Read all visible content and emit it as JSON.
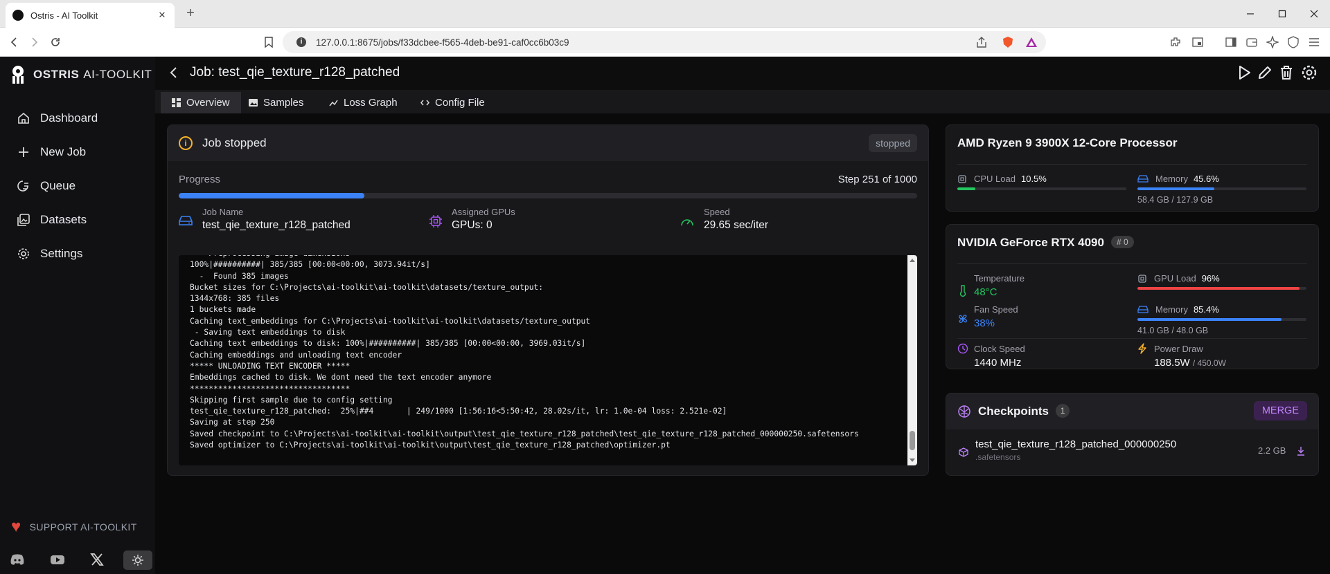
{
  "browser": {
    "tab_title": "Ostris - AI Toolkit",
    "url": "127.0.0.1:8675/jobs/f33dcbee-f565-4deb-be91-caf0cc6b03c9"
  },
  "sidebar": {
    "brand_bold": "OSTRIS",
    "brand_rest": "AI-TOOLKIT",
    "items": [
      {
        "label": "Dashboard",
        "icon": "home-icon"
      },
      {
        "label": "New Job",
        "icon": "plus-icon"
      },
      {
        "label": "Queue",
        "icon": "queue-icon"
      },
      {
        "label": "Datasets",
        "icon": "images-icon"
      },
      {
        "label": "Settings",
        "icon": "gear-icon"
      }
    ],
    "support_label": "SUPPORT AI-TOOLKIT"
  },
  "header": {
    "title": "Job: test_qie_texture_r128_patched"
  },
  "tabs": [
    {
      "label": "Overview",
      "active": true
    },
    {
      "label": "Samples"
    },
    {
      "label": "Loss Graph"
    },
    {
      "label": "Config File"
    }
  ],
  "job": {
    "status_title": "Job stopped",
    "status_badge": "stopped",
    "progress_label": "Progress",
    "step_text": "Step 251 of 1000",
    "progress_fraction": 0.251,
    "job_name_label": "Job Name",
    "job_name": "test_qie_texture_r128_patched",
    "gpus_label": "Assigned GPUs",
    "gpus": "GPUs: 0",
    "speed_label": "Speed",
    "speed": "29.65 sec/iter",
    "log": "  - Preprocessing image dimensions\n100%|##########| 385/385 [00:00<00:00, 3073.94it/s]\n  -  Found 385 images\nBucket sizes for C:\\Projects\\ai-toolkit\\ai-toolkit\\datasets/texture_output:\n1344x768: 385 files\n1 buckets made\nCaching text_embeddings for C:\\Projects\\ai-toolkit\\ai-toolkit\\datasets/texture_output\n - Saving text embeddings to disk\nCaching text embeddings to disk: 100%|##########| 385/385 [00:00<00:00, 3969.03it/s]\nCaching embeddings and unloading text encoder\n***** UNLOADING TEXT ENCODER *****\nEmbeddings cached to disk. We dont need the text encoder anymore\n**********************************\nSkipping first sample due to config setting\ntest_qie_texture_r128_patched:  25%|##4       | 249/1000 [1:56:16<5:50:42, 28.02s/it, lr: 1.0e-04 loss: 2.521e-02]\nSaving at step 250\nSaved checkpoint to C:\\Projects\\ai-toolkit\\ai-toolkit\\output\\test_qie_texture_r128_patched\\test_qie_texture_r128_patched_000000250.safetensors\nSaved optimizer to C:\\Projects\\ai-toolkit\\ai-toolkit\\output\\test_qie_texture_r128_patched\\optimizer.pt"
  },
  "cpu": {
    "name": "AMD Ryzen 9 3900X 12-Core Processor",
    "load_label": "CPU Load",
    "load": "10.5%",
    "load_fraction": 0.105,
    "mem_label": "Memory",
    "mem": "45.6%",
    "mem_fraction": 0.456,
    "mem_detail": "58.4 GB / 127.9 GB"
  },
  "gpu": {
    "name": "NVIDIA GeForce RTX 4090",
    "index_badge": "# 0",
    "temp_label": "Temperature",
    "temp": "48°C",
    "load_label": "GPU Load",
    "load": "96%",
    "load_fraction": 0.96,
    "fan_label": "Fan Speed",
    "fan": "38%",
    "mem_label": "Memory",
    "mem": "85.4%",
    "mem_fraction": 0.854,
    "mem_detail": "41.0 GB / 48.0 GB",
    "clock_label": "Clock Speed",
    "clock": "1440 MHz",
    "power_label": "Power Draw",
    "power": "188.5W",
    "power_max": "/ 450.0W"
  },
  "checkpoints": {
    "title": "Checkpoints",
    "count": "1",
    "merge_label": "MERGE",
    "items": [
      {
        "name": "test_qie_texture_r128_patched_000000250",
        "ext": ".safetensors",
        "size": "2.2 GB"
      }
    ]
  },
  "colors": {
    "accent": "#3b82f6",
    "warning": "#f5b22b",
    "danger": "#ef4444",
    "success": "#22c55e",
    "purple": "#c084fc"
  }
}
